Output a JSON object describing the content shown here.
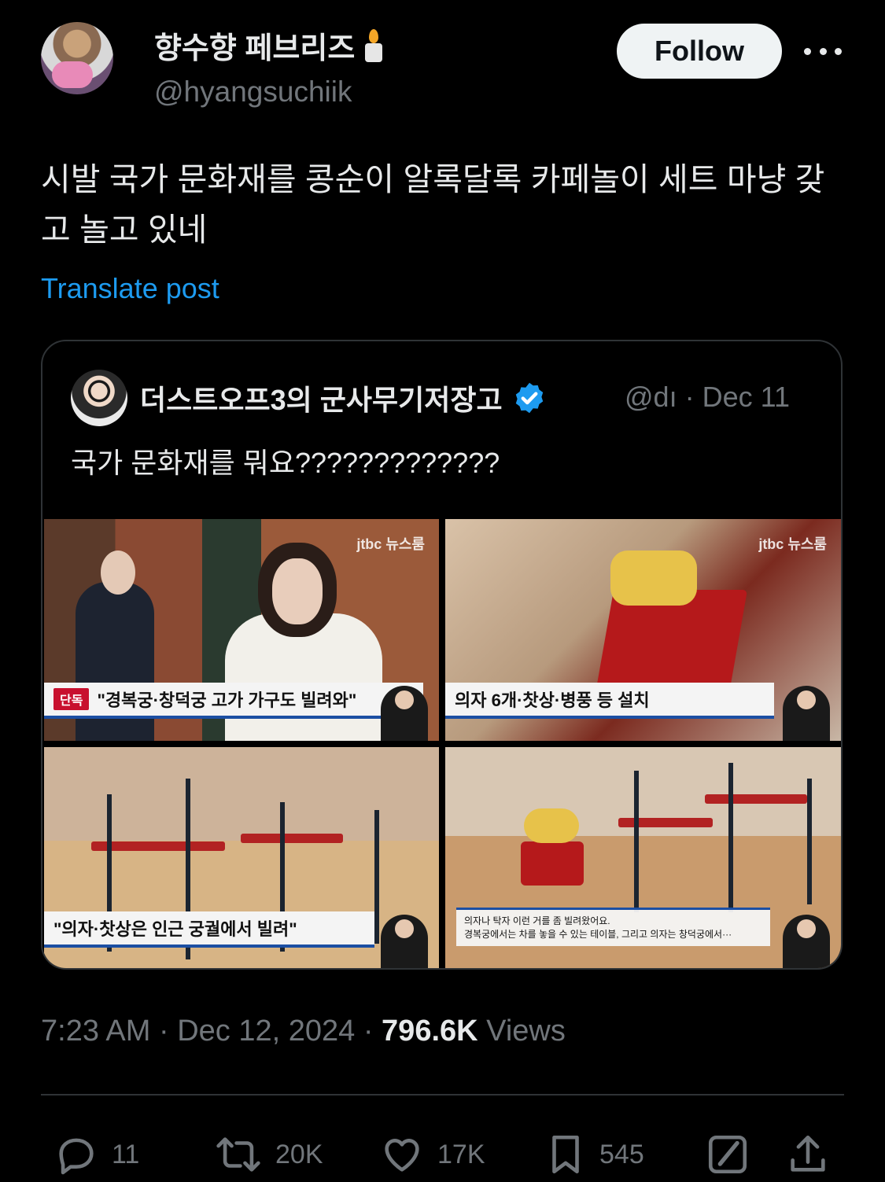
{
  "author": {
    "display_name": "향수향 페브리즈",
    "handle": "@hyangsuchiik",
    "emoji_icon": "candle-icon"
  },
  "follow_label": "Follow",
  "post": {
    "text": "시발 국가 문화재를 콩순이 알록달록 카페놀이 세트 마냥 갖고 놀고 있네",
    "translate_label": "Translate post"
  },
  "quote": {
    "display_name": "더스트오프3의 군사무기저장고",
    "verified": true,
    "handle_truncated": "@dı",
    "separator": "·",
    "date": "Dec 11",
    "text": "국가 문화재를 뭐요?????????????",
    "images": [
      {
        "tag": "단독",
        "caption": "\"경복궁·창덕궁 고가 가구도 빌려와\"",
        "logo": "jtbc 뉴스룸"
      },
      {
        "caption": "의자 6개·찻상·병풍 등 설치",
        "logo": "jtbc 뉴스룸"
      },
      {
        "caption": "\"의자·찻상은 인근 궁궐에서 빌려\""
      },
      {
        "caption_line1": "의자나 탁자 이런 거를 좀 빌려왔어요.",
        "caption_line2": "경복궁에서는 차를 놓을 수 있는 테이블, 그리고 의자는 창덕궁에서···"
      }
    ]
  },
  "meta": {
    "time": "7:23 AM",
    "separator": "·",
    "date": "Dec 12, 2024",
    "views_count": "796.6K",
    "views_label": "Views"
  },
  "actions": {
    "replies": "11",
    "reposts": "20K",
    "likes": "17K",
    "bookmarks": "545"
  },
  "colors": {
    "background": "#000000",
    "text": "#e7e9ea",
    "secondary": "#71767b",
    "link": "#1d9bf0",
    "border": "#2f3336",
    "verified": "#1d9bf0"
  }
}
